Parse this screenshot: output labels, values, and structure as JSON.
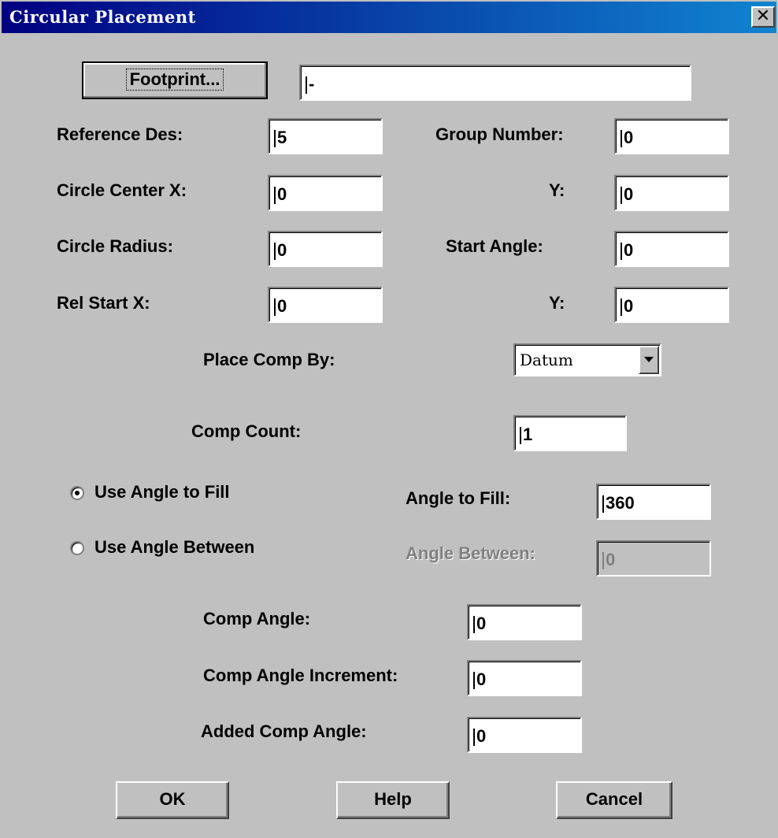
{
  "window": {
    "title": "Circular Placement",
    "close_glyph": "✕"
  },
  "footprint": {
    "button_label": "Footprint...",
    "value": "-"
  },
  "fields": {
    "reference_des": {
      "label": "Reference Des:",
      "value": "5"
    },
    "group_number": {
      "label": "Group Number:",
      "value": "0"
    },
    "circle_center_x": {
      "label": "Circle Center X:",
      "value": "0"
    },
    "circle_center_y": {
      "label": "Y:",
      "value": "0"
    },
    "circle_radius": {
      "label": "Circle Radius:",
      "value": "0"
    },
    "start_angle": {
      "label": "Start Angle:",
      "value": "0"
    },
    "rel_start_x": {
      "label": "Rel Start X:",
      "value": "0"
    },
    "rel_start_y": {
      "label": "Y:",
      "value": "0"
    },
    "comp_count": {
      "label": "Comp Count:",
      "value": "1"
    },
    "angle_to_fill": {
      "label": "Angle to Fill:",
      "value": "360"
    },
    "angle_between": {
      "label": "Angle Between:",
      "value": "0",
      "disabled": true
    },
    "comp_angle": {
      "label": "Comp Angle:",
      "value": "0"
    },
    "comp_angle_increment": {
      "label": "Comp Angle Increment:",
      "value": "0"
    },
    "added_comp_angle": {
      "label": "Added Comp Angle:",
      "value": "0"
    }
  },
  "place_comp_by": {
    "label": "Place Comp By:",
    "selected": "Datum"
  },
  "radios": {
    "use_angle_to_fill": {
      "label": "Use Angle to Fill",
      "checked": true
    },
    "use_angle_between": {
      "label": "Use Angle Between",
      "checked": false
    }
  },
  "buttons": {
    "ok": "OK",
    "help": "Help",
    "cancel": "Cancel"
  },
  "colors": {
    "face": "#c0c0c0",
    "title_start": "#000080",
    "title_end": "#1084d0",
    "disabled_text": "#808080"
  },
  "icons": {
    "close": "close-icon",
    "dropdown": "chevron-down-icon",
    "radio": "radio-icon"
  }
}
